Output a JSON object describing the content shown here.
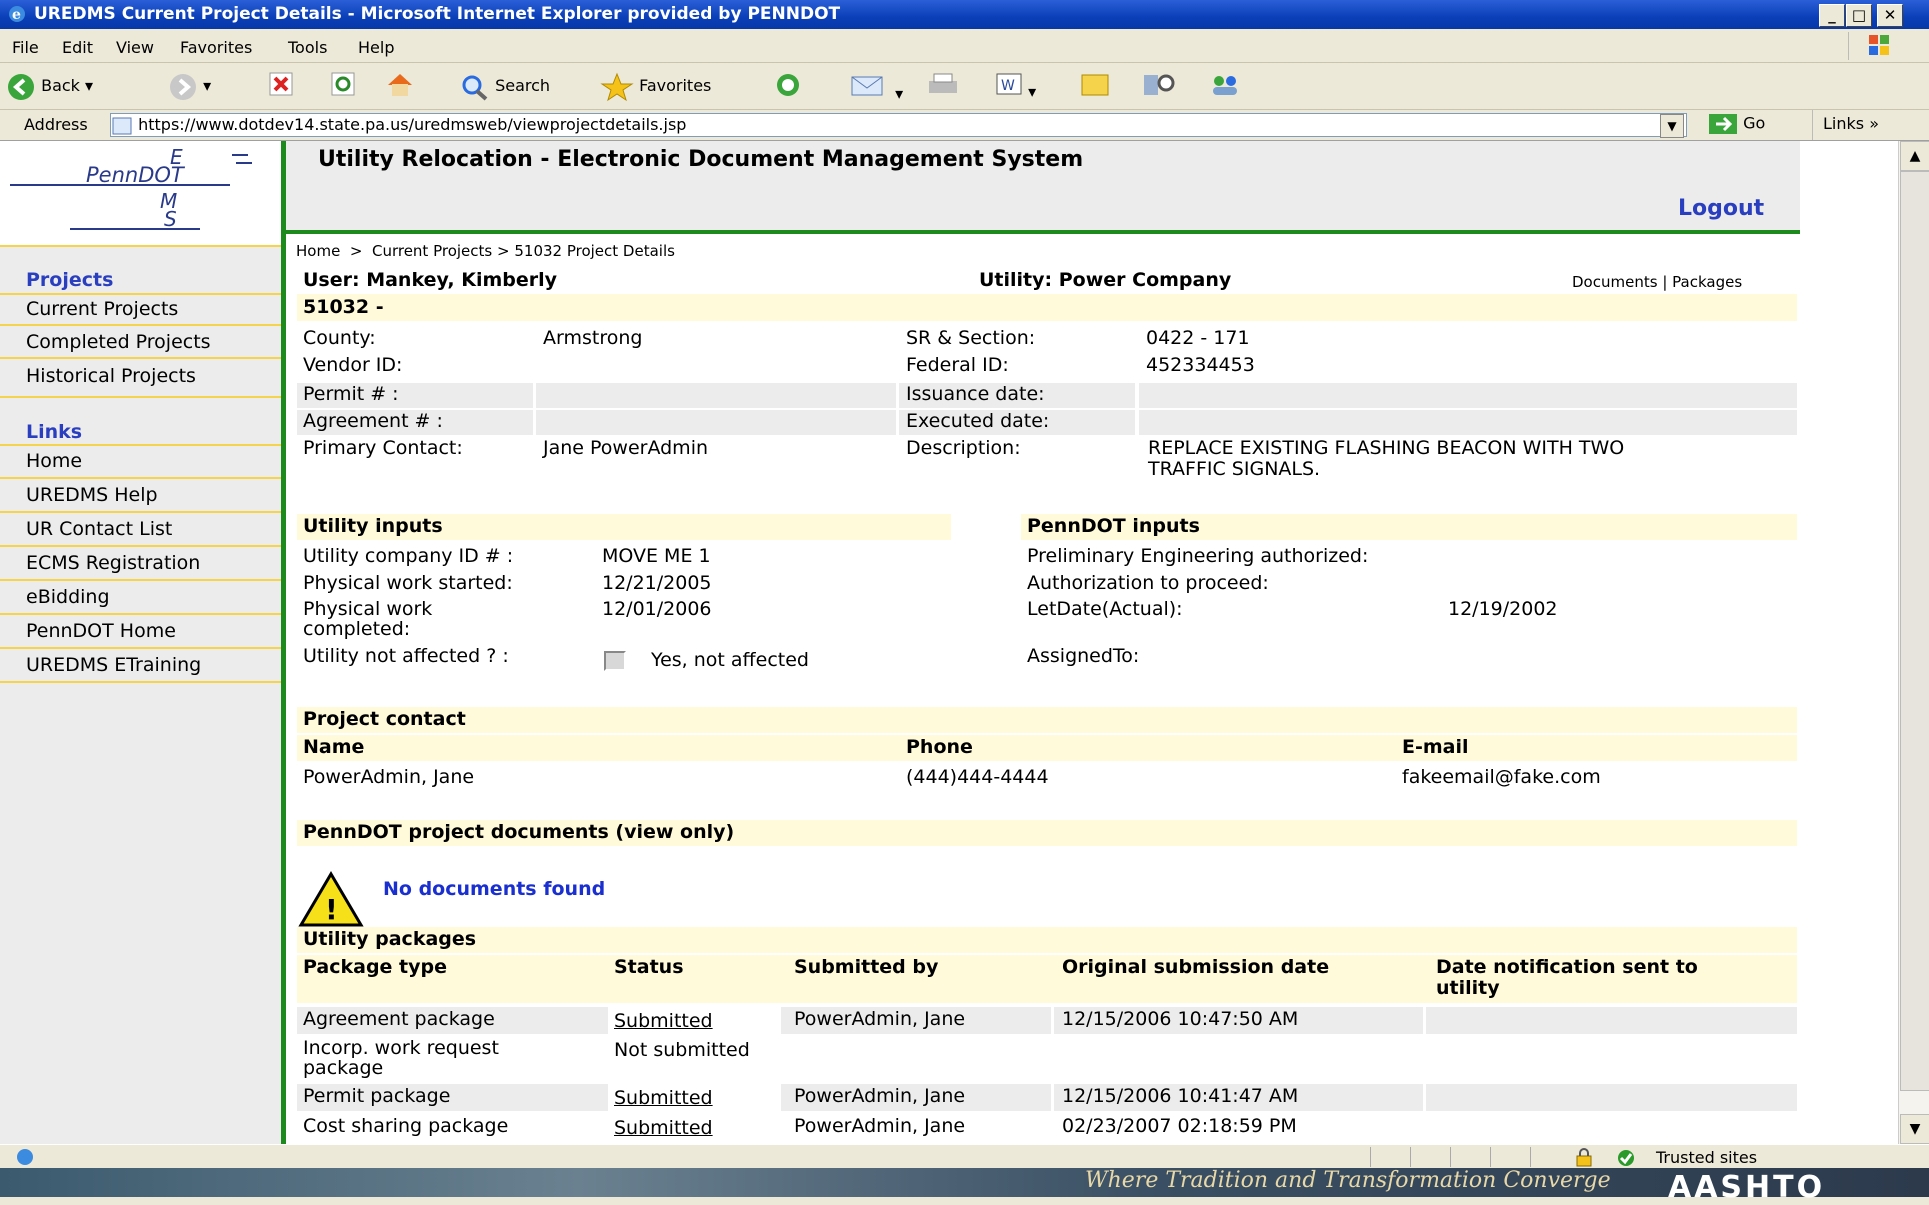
{
  "window": {
    "title": "UREDMS Current Project Details - Microsoft Internet Explorer provided by PENNDOT"
  },
  "menu": [
    "File",
    "Edit",
    "View",
    "Favorites",
    "Tools",
    "Help"
  ],
  "toolbar": {
    "back": "Back",
    "search": "Search",
    "favorites": "Favorites"
  },
  "address": {
    "label": "Address",
    "url": "https://www.dotdev14.state.pa.us/uredmsweb/viewprojectdetails.jsp",
    "go": "Go",
    "links": "Links"
  },
  "logo": {
    "e": "E",
    "penndot": "PennDOT",
    "m": "M",
    "s": "S"
  },
  "header": {
    "title": "Utility Relocation - Electronic Document Management System",
    "logout": "Logout"
  },
  "sidebar": {
    "projects_head": "Projects",
    "projects": [
      "Current Projects",
      "Completed Projects",
      "Historical Projects"
    ],
    "links_head": "Links",
    "links": [
      "Home",
      "UREDMS Help",
      "UR Contact List",
      "ECMS Registration",
      "eBidding",
      "PennDOT Home",
      "UREDMS ETraining"
    ]
  },
  "breadcrumb": {
    "home": "Home",
    "sep": ">",
    "current": "Current Projects",
    "page": "51032 Project Details"
  },
  "user": {
    "label": "User: Mankey, Kimberly",
    "utility": "Utility: Power Company",
    "documents": "Documents",
    "sep": "|",
    "packages": "Packages"
  },
  "project": {
    "id": "51032 -",
    "county_label": "County:",
    "county": "Armstrong",
    "vendor_label": "Vendor ID:",
    "vendor": "",
    "permit_label": "Permit # :",
    "permit": "",
    "agreement_label": "Agreement # :",
    "agreement": "",
    "contact_label": "Primary Contact:",
    "contact": "Jane PowerAdmin",
    "sr_label": "SR & Section:",
    "sr": "0422 - 171",
    "federal_label": "Federal ID:",
    "federal": "452334453",
    "issuance_label": "Issuance date:",
    "issuance": "",
    "executed_label": "Executed date:",
    "executed": "",
    "desc_label": "Description:",
    "desc_line1": "REPLACE EXISTING FLASHING BEACON WITH TWO",
    "desc_line2": "TRAFFIC SIGNALS."
  },
  "utility_inputs": {
    "head": "Utility inputs",
    "company_label": "Utility company ID # :",
    "company": "MOVE ME 1",
    "started_label": "Physical work started:",
    "started": "12/21/2005",
    "completed_label1": "Physical work",
    "completed_label2": "completed:",
    "completed": "12/01/2006",
    "not_affected_label": "Utility not affected ? :",
    "not_affected_text": "Yes, not affected"
  },
  "penndot_inputs": {
    "head": "PennDOT inputs",
    "prelim_label": "Preliminary Engineering authorized:",
    "auth_label": "Authorization to proceed:",
    "letdate_label": "LetDate(Actual):",
    "letdate": "12/19/2002",
    "assigned_label": "AssignedTo:"
  },
  "project_contact": {
    "head": "Project contact",
    "col_name": "Name",
    "col_phone": "Phone",
    "col_email": "E-mail",
    "name": "PowerAdmin, Jane",
    "phone": "(444)444-4444",
    "email": "fakeemail@fake.com"
  },
  "documents": {
    "head": "PennDOT project documents (view only)",
    "none": "No documents found"
  },
  "packages": {
    "head": "Utility packages",
    "columns": [
      "Package type",
      "Status",
      "Submitted by",
      "Original submission date",
      "Date notification sent to",
      "utility"
    ],
    "rows": [
      {
        "type": "Agreement package",
        "type2": "",
        "status": "Submitted",
        "by": "PowerAdmin, Jane",
        "date": "12/15/2006 10:47:50 AM"
      },
      {
        "type": "Incorp. work request",
        "type2": "package",
        "status": "Not submitted",
        "by": "",
        "date": ""
      },
      {
        "type": "Permit package",
        "type2": "",
        "status": "Submitted",
        "by": "PowerAdmin, Jane",
        "date": "12/15/2006 10:41:47 AM"
      },
      {
        "type": "Cost sharing package",
        "type2": "",
        "status": "Submitted",
        "by": "PowerAdmin, Jane",
        "date": "02/23/2007 02:18:59 PM"
      }
    ]
  },
  "statusbar": {
    "zone": "Trusted sites"
  },
  "footer": {
    "tagline": "Where Tradition and Transformation Converge",
    "brand": "AASHTO"
  }
}
